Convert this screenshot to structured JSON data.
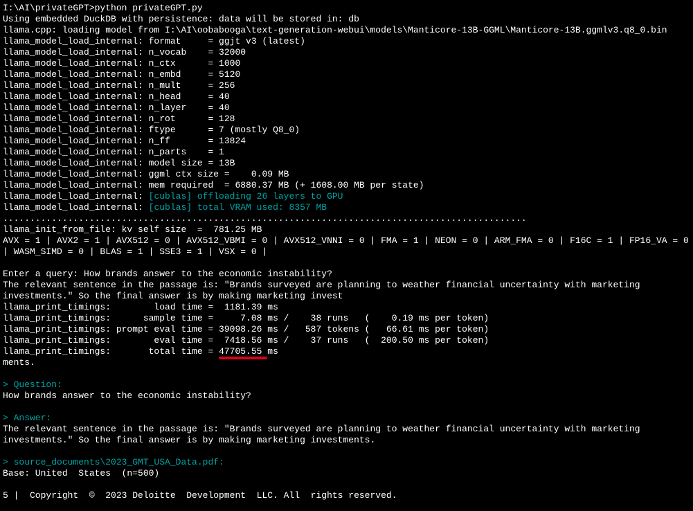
{
  "prompt_line": "I:\\AI\\privateGPT>python privateGPT.py",
  "using_line": "Using embedded DuckDB with persistence: data will be stored in: db",
  "loading_line": "llama.cpp: loading model from I:\\AI\\oobabooga\\text-generation-webui\\models\\Manticore-13B-GGML\\Manticore-13B.ggmlv3.q8_0.bin",
  "model_internal": [
    "llama_model_load_internal: format     = ggjt v3 (latest)",
    "llama_model_load_internal: n_vocab    = 32000",
    "llama_model_load_internal: n_ctx      = 1000",
    "llama_model_load_internal: n_embd     = 5120",
    "llama_model_load_internal: n_mult     = 256",
    "llama_model_load_internal: n_head     = 40",
    "llama_model_load_internal: n_layer    = 40",
    "llama_model_load_internal: n_rot      = 128",
    "llama_model_load_internal: ftype      = 7 (mostly Q8_0)",
    "llama_model_load_internal: n_ff       = 13824",
    "llama_model_load_internal: n_parts    = 1",
    "llama_model_load_internal: model size = 13B",
    "llama_model_load_internal: ggml ctx size =    0.09 MB",
    "llama_model_load_internal: mem required  = 6880.37 MB (+ 1608.00 MB per state)"
  ],
  "cublas_prefix": "llama_model_load_internal: ",
  "cublas1": "[cublas] offloading 26 layers to GPU",
  "cublas2": "[cublas] total VRAM used: 8357 MB",
  "dots": ".................................................................................................",
  "kv_line": "llama_init_from_file: kv self size  =  781.25 MB",
  "avx_line": "AVX = 1 | AVX2 = 1 | AVX512 = 0 | AVX512_VBMI = 0 | AVX512_VNNI = 0 | FMA = 1 | NEON = 0 | ARM_FMA = 0 | F16C = 1 | FP16_VA = 0 | WASM_SIMD = 0 | BLAS = 1 | SSE3 = 1 | VSX = 0 |",
  "enter_query": "Enter a query: How brands answer to the economic instability?",
  "relevant_wrap": " The relevant sentence in the passage is: \"Brands surveyed are planning to weather financial uncertainty with marketing investments.\" So the final answer is by making marketing invest",
  "timings": [
    "llama_print_timings:        load time =  1181.39 ms",
    "llama_print_timings:      sample time =     7.08 ms /    38 runs   (    0.19 ms per token)",
    "llama_print_timings: prompt eval time = 39098.26 ms /   587 tokens (   66.61 ms per token)",
    "llama_print_timings:        eval time =  7418.56 ms /    37 runs   (  200.50 ms per token)"
  ],
  "total_prefix": "llama_print_timings:       total time = ",
  "total_value": "47705.55",
  "total_suffix": " ms",
  "ments": "ments.",
  "question_hdr": "> Question:",
  "question_txt": "How brands answer to the economic instability?",
  "answer_hdr": "> Answer:",
  "answer_txt": " The relevant sentence in the passage is: \"Brands surveyed are planning to weather financial uncertainty with marketing investments.\" So the final answer is by making marketing investments.",
  "srcdoc": "> source_documents\\2023_GMT_USA_Data.pdf:",
  "base": "Base: United  States  (n=500)",
  "copyright": "5 |  Copyright  ©  2023 Deloitte  Development  LLC. All  rights reserved."
}
